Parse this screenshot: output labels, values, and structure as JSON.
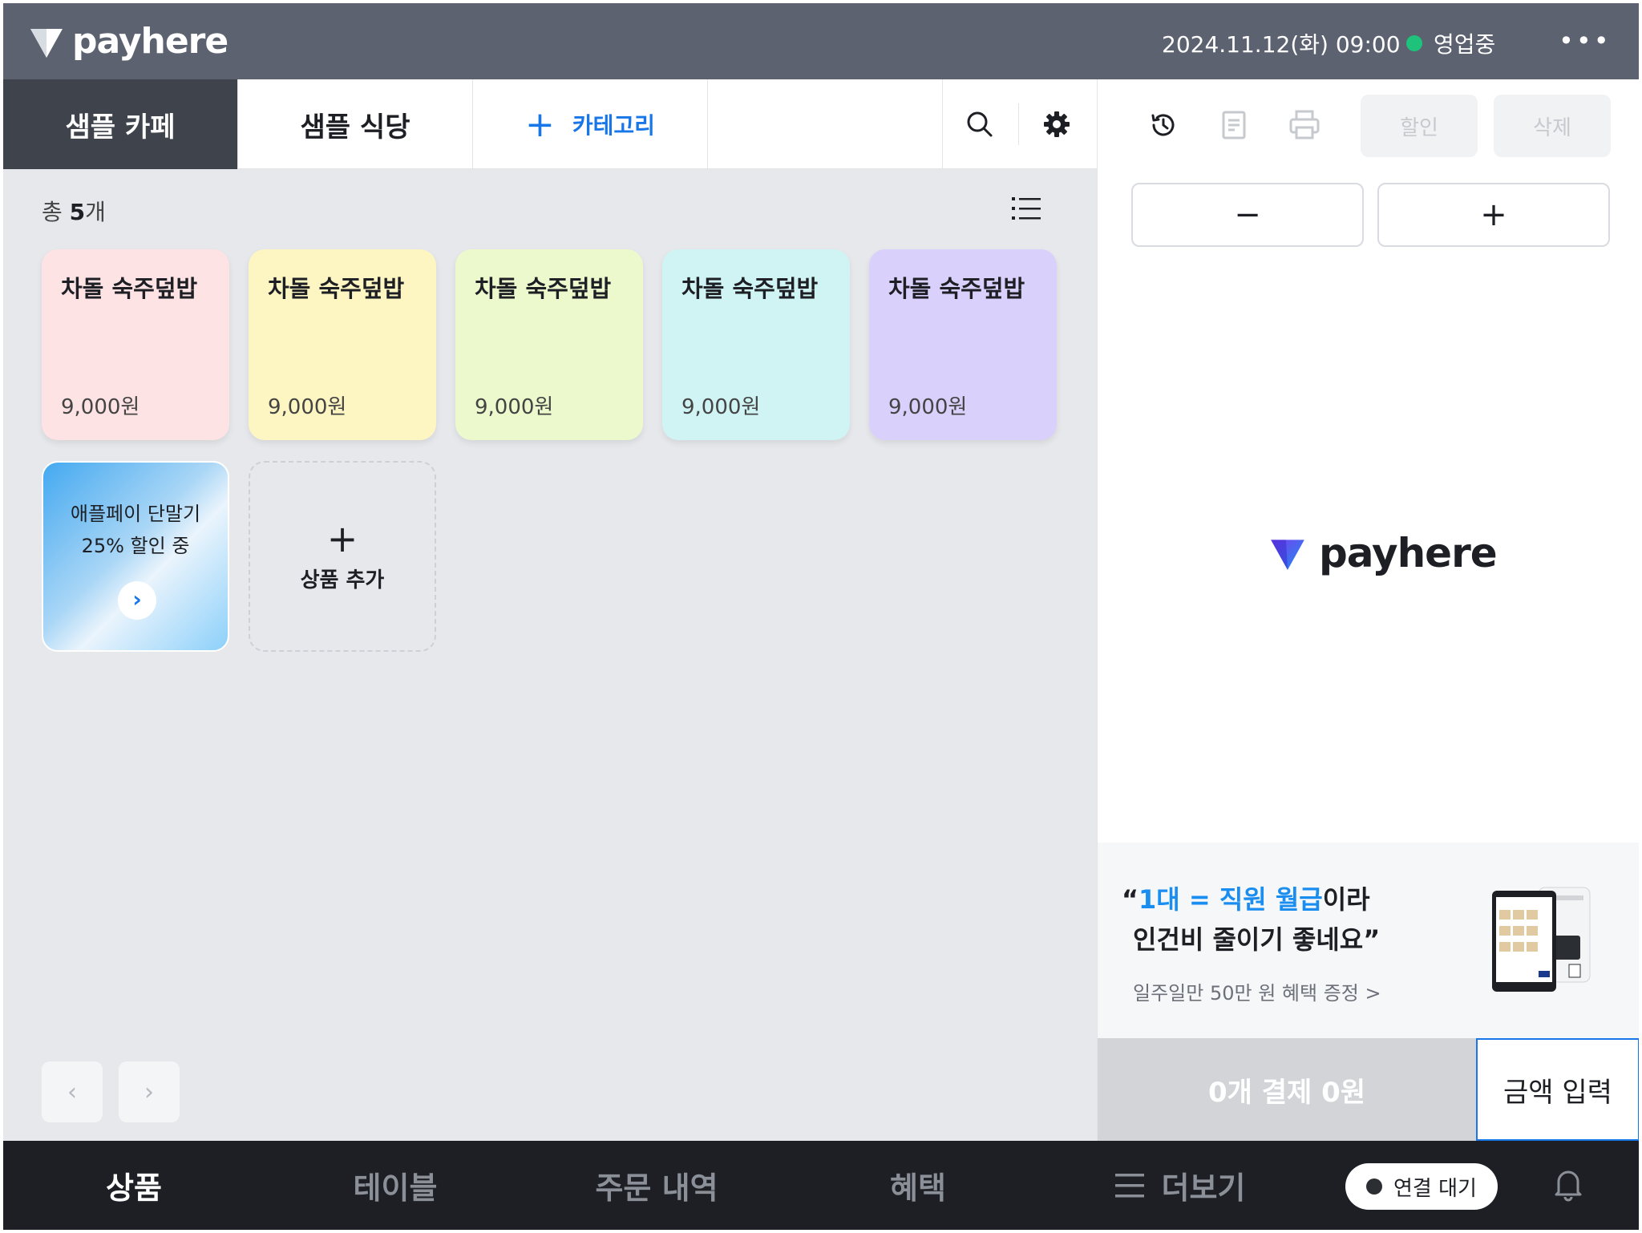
{
  "header": {
    "brand": "payhere",
    "datetime": "2024.11.12(화) 09:00",
    "status": "영업중",
    "more_icon": "more-icon",
    "colors": {
      "bar": "#5c6270",
      "status_dot": "#1ec27a"
    }
  },
  "categories": {
    "tabs": [
      {
        "label": "샘플 카페",
        "active": true
      },
      {
        "label": "샘플 식당",
        "active": false
      }
    ],
    "add_label": "카테고리",
    "accent": "#1877e8"
  },
  "products": {
    "count_prefix": "총 ",
    "count_value": "5",
    "count_suffix": "개",
    "items": [
      {
        "name": "차돌 숙주덮밥",
        "price": "9,000원",
        "color": "#fde3e4"
      },
      {
        "name": "차돌 숙주덮밥",
        "price": "9,000원",
        "color": "#fdf6c2"
      },
      {
        "name": "차돌 숙주덮밥",
        "price": "9,000원",
        "color": "#ebf9cc"
      },
      {
        "name": "차돌 숙주덮밥",
        "price": "9,000원",
        "color": "#d0f4f4"
      },
      {
        "name": "차돌 숙주덮밥",
        "price": "9,000원",
        "color": "#d9d0fb"
      }
    ],
    "promo": {
      "line1": "애플페이 단말기",
      "line2": "25% 할인 중"
    },
    "add_product": "상품 추가",
    "pager": {
      "prev": "‹",
      "next": "›"
    }
  },
  "order_panel": {
    "discount_label": "할인",
    "delete_label": "삭제",
    "minus": "−",
    "plus": "+",
    "brand": "payhere",
    "ad": {
      "open_quote": "“",
      "highlight": "1대 = 직원 월급",
      "line1_rest": "이라",
      "line2": "인건비 줄이기 좋네요”",
      "line3": "일주일만 50만 원 혜택 증정 >"
    },
    "pay_summary": "0개 결제  0원",
    "amount_input": "금액 입력"
  },
  "bottom_nav": {
    "items": [
      "상품",
      "테이블",
      "주문 내역",
      "혜택"
    ],
    "more": "더보기",
    "connection": "연결 대기"
  }
}
